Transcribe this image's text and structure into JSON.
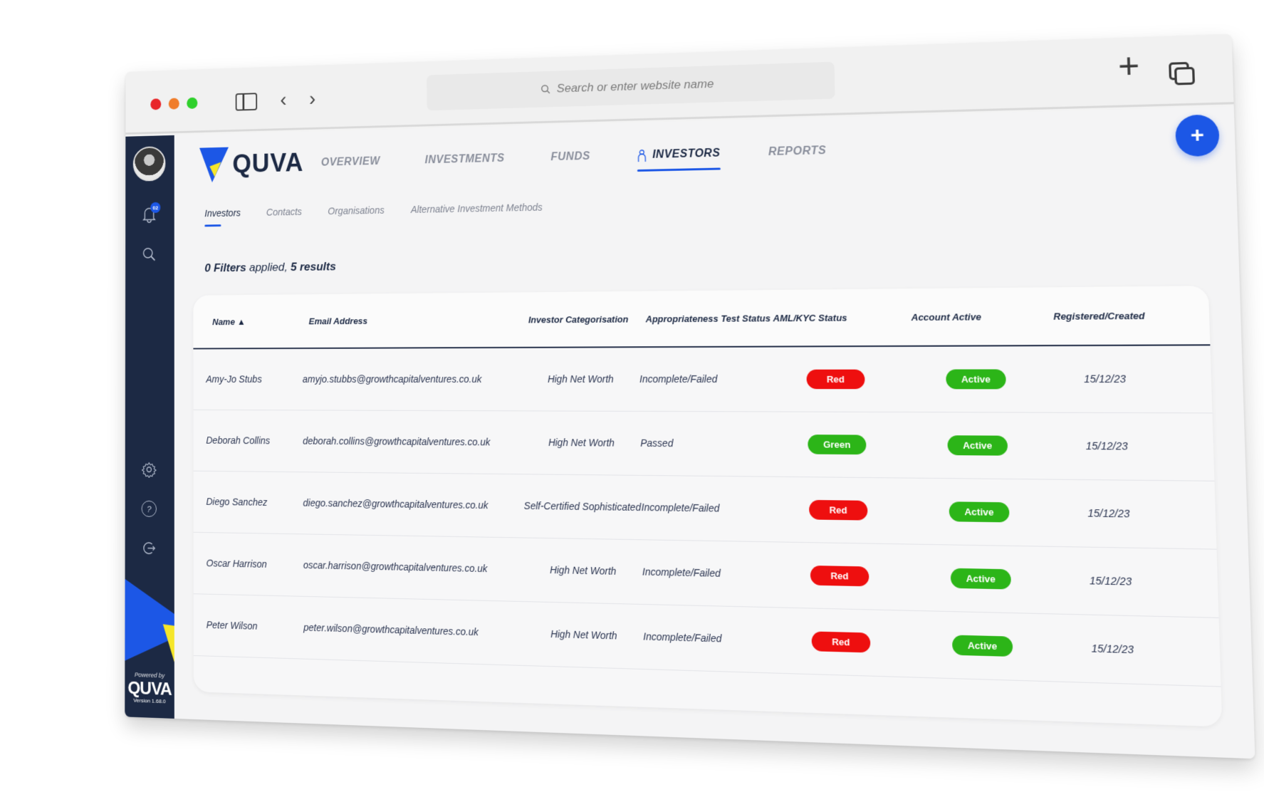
{
  "browser": {
    "url_placeholder": "Search or enter website name",
    "new_tab_glyph": "+",
    "back_glyph": "‹",
    "forward_glyph": "›"
  },
  "sidebar": {
    "notification_count": "02",
    "powered_by": "Powered by",
    "brand": "QUVA",
    "version": "Version 1.68.0"
  },
  "app": {
    "logo_text": "QUVA",
    "nav": [
      {
        "label": "OVERVIEW",
        "active": false
      },
      {
        "label": "INVESTMENTS",
        "active": false
      },
      {
        "label": "FUNDS",
        "active": false
      },
      {
        "label": "INVESTORS",
        "active": true
      },
      {
        "label": "REPORTS",
        "active": false
      }
    ],
    "fab_glyph": "+",
    "subnav": [
      {
        "label": "Investors",
        "active": true
      },
      {
        "label": "Contacts",
        "active": false
      },
      {
        "label": "Organisations",
        "active": false
      },
      {
        "label": "Alternative Investment Methods",
        "active": false
      }
    ],
    "summary": {
      "filters": "0 Filters",
      "applied": " applied, ",
      "results": "5 results"
    }
  },
  "table": {
    "columns": [
      "Name ▲",
      "Email Address",
      "Investor Categorisation",
      "Appropriateness Test Status",
      "AML/KYC Status",
      "Account Active",
      "Registered/Created"
    ],
    "rows": [
      {
        "name": "Amy-Jo Stubs",
        "email": "amyjo.stubbs@growthcapitalventures.co.uk",
        "category": "High Net Worth",
        "test": "Incomplete/Failed",
        "aml": "Red",
        "aml_color": "red",
        "active": "Active",
        "created": "15/12/23"
      },
      {
        "name": "Deborah Collins",
        "email": "deborah.collins@growthcapitalventures.co.uk",
        "category": "High Net Worth",
        "test": "Passed",
        "aml": "Green",
        "aml_color": "green",
        "active": "Active",
        "created": "15/12/23"
      },
      {
        "name": "Diego Sanchez",
        "email": "diego.sanchez@growthcapitalventures.co.uk",
        "category": "Self-Certified Sophisticated",
        "test": "Incomplete/Failed",
        "aml": "Red",
        "aml_color": "red",
        "active": "Active",
        "created": "15/12/23"
      },
      {
        "name": "Oscar Harrison",
        "email": "oscar.harrison@growthcapitalventures.co.uk",
        "category": "High Net Worth",
        "test": "Incomplete/Failed",
        "aml": "Red",
        "aml_color": "red",
        "active": "Active",
        "created": "15/12/23"
      },
      {
        "name": "Peter Wilson",
        "email": "peter.wilson@growthcapitalventures.co.uk",
        "category": "High Net Worth",
        "test": "Incomplete/Failed",
        "aml": "Red",
        "aml_color": "red",
        "active": "Active",
        "created": "15/12/23"
      }
    ]
  },
  "colors": {
    "brand_navy": "#1c2944",
    "brand_blue": "#1c57e6",
    "brand_yellow": "#f5e62a",
    "status_red": "#ee0f0f",
    "status_green": "#2cb518"
  }
}
